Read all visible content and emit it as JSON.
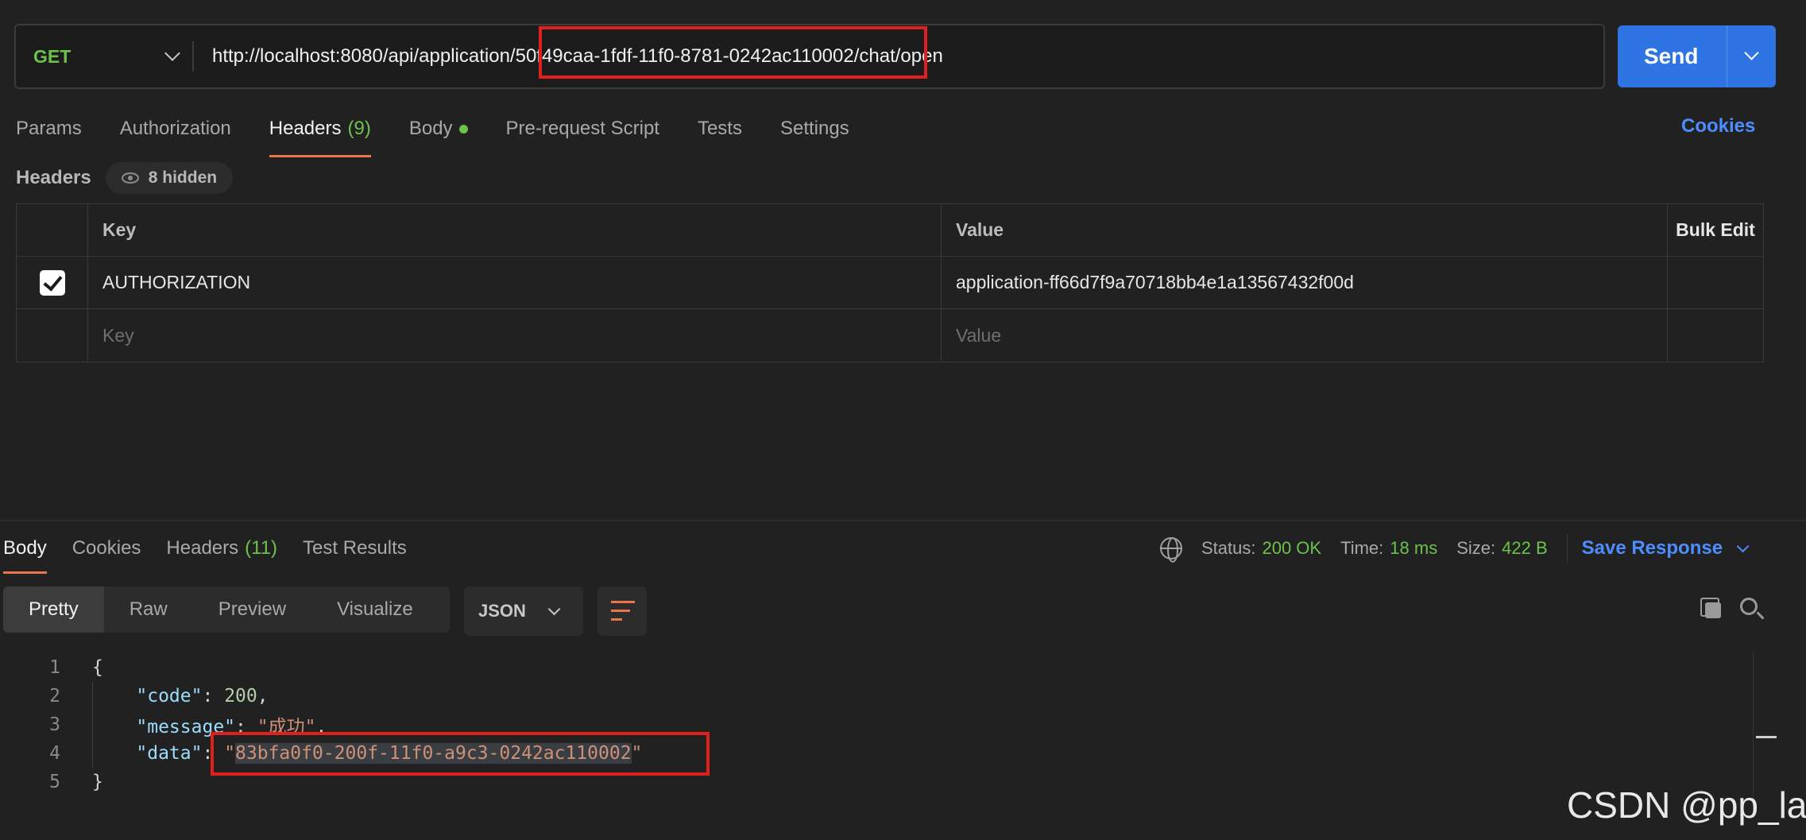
{
  "request": {
    "method": "GET",
    "url": "http://localhost:8080/api/application/50f49caa-1fdf-11f0-8781-0242ac110002/chat/open",
    "send_label": "Send"
  },
  "req_tabs": [
    {
      "label": "Params"
    },
    {
      "label": "Authorization"
    },
    {
      "label": "Headers",
      "count": "(9)"
    },
    {
      "label": "Body"
    },
    {
      "label": "Pre-request Script"
    },
    {
      "label": "Tests"
    },
    {
      "label": "Settings"
    }
  ],
  "cookies_label": "Cookies",
  "headers_section": {
    "title": "Headers",
    "hidden_label": "8 hidden",
    "columns": {
      "key": "Key",
      "value": "Value",
      "bulk": "Bulk Edit"
    },
    "rows": [
      {
        "key": "AUTHORIZATION",
        "value": "application-ff66d7f9a70718bb4e1a13567432f00d",
        "checked": true
      }
    ],
    "empty_row": {
      "key_placeholder": "Key",
      "value_placeholder": "Value"
    }
  },
  "resp_tabs": [
    {
      "label": "Body"
    },
    {
      "label": "Cookies"
    },
    {
      "label": "Headers",
      "count": "(11)"
    },
    {
      "label": "Test Results"
    }
  ],
  "status": {
    "status_label": "Status:",
    "status_value": "200 OK",
    "time_label": "Time:",
    "time_value": "18 ms",
    "size_label": "Size:",
    "size_value": "422 B",
    "save_label": "Save Response"
  },
  "view_modes": [
    "Pretty",
    "Raw",
    "Preview",
    "Visualize"
  ],
  "format": "JSON",
  "code": {
    "lines": [
      "1",
      "2",
      "3",
      "4",
      "5"
    ],
    "open_brace": "{",
    "close_brace": "}",
    "code_key": "\"code\"",
    "code_val": "200",
    "message_key": "\"message\"",
    "message_val": "\"成功\"",
    "data_key": "\"data\"",
    "data_val_inner": "83bfa0f0-200f-11f0-a9c3-0242ac110002"
  },
  "watermark": "CSDN @pp_lan",
  "colors": {
    "accent": "#2f74e3",
    "active_tab": "#e8764a",
    "success": "#6cc24a",
    "highlight": "#e01f1f"
  }
}
